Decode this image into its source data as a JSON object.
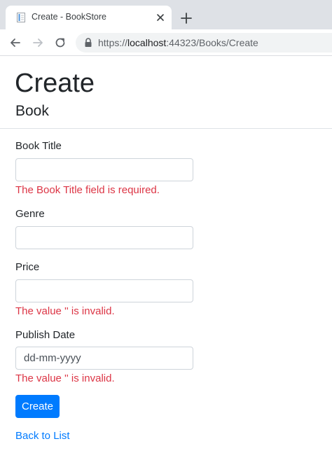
{
  "browser": {
    "tab": {
      "title": "Create - BookStore"
    },
    "address_bar": {
      "scheme": "https://",
      "host": "localhost",
      "path": ":44323/Books/Create"
    }
  },
  "page": {
    "title": "Create",
    "subtitle": "Book",
    "form": {
      "fields": [
        {
          "label": "Book Title",
          "value": "",
          "placeholder": "",
          "error": "The Book Title field is required."
        },
        {
          "label": "Genre",
          "value": "",
          "placeholder": "",
          "error": ""
        },
        {
          "label": "Price",
          "value": "",
          "placeholder": "",
          "error": "The value '' is invalid."
        },
        {
          "label": "Publish Date",
          "value": "",
          "placeholder": "dd-mm-yyyy",
          "error": "The value '' is invalid."
        }
      ],
      "submit_label": "Create"
    },
    "back_link": "Back to List"
  },
  "colors": {
    "primary": "#007bff",
    "error": "#dc3545",
    "tabstrip": "#dee1e6",
    "omnibox": "#f1f3f4",
    "text": "#212529"
  }
}
